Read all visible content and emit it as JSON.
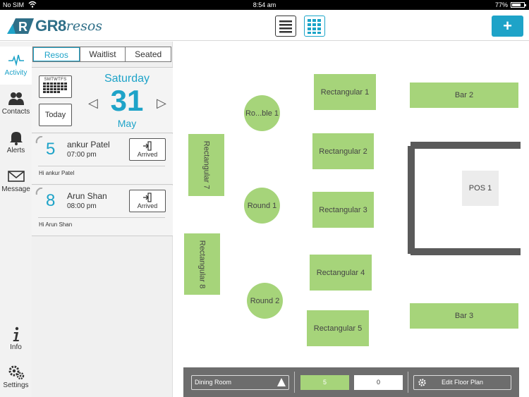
{
  "status_bar": {
    "carrier": "No SIM",
    "time": "8:54 am",
    "battery": "77%",
    "battery_level": 0.77
  },
  "header": {
    "logo_text": "GR8",
    "logo_text_italic": "resos",
    "logo_letter": "R",
    "list_view_icon": "list-icon",
    "grid_view_icon": "grid-icon",
    "add_label": "+"
  },
  "nav": {
    "items": [
      {
        "label": "Activity",
        "icon": "activity-icon",
        "active": true
      },
      {
        "label": "Contacts",
        "icon": "contacts-icon"
      },
      {
        "label": "Alerts",
        "icon": "bell-icon"
      },
      {
        "label": "Message",
        "icon": "envelope-icon"
      },
      {
        "label": "Info",
        "icon": "info-icon"
      },
      {
        "label": "Settings",
        "icon": "gear-icon"
      }
    ]
  },
  "panel": {
    "tabs": [
      {
        "label": "Resos",
        "active": true
      },
      {
        "label": "Waitlist"
      },
      {
        "label": "Seated"
      }
    ],
    "calendar_days": "SMTWTFS",
    "today_label": "Today",
    "prev_arrow": "◁",
    "next_arrow": "▷",
    "date": {
      "day_name": "Saturday",
      "day": "31",
      "month": "May"
    },
    "reservations": [
      {
        "party": "5",
        "name": "ankur Patel",
        "time": "07:00 pm",
        "status": "Arrived",
        "note": "Hi ankur Patel"
      },
      {
        "party": "8",
        "name": "Arun Shan",
        "time": "08:00 pm",
        "status": "Arrived",
        "note": "Hi Arun Shan"
      }
    ]
  },
  "floor": {
    "tables": [
      {
        "name": "Rectangular 1",
        "shape": "rect"
      },
      {
        "name": "Ro...ble 1",
        "shape": "round"
      },
      {
        "name": "Rectangular 2",
        "shape": "rect"
      },
      {
        "name": "Round 1",
        "shape": "round"
      },
      {
        "name": "Rectangular 3",
        "shape": "rect"
      },
      {
        "name": "Rectangular 4",
        "shape": "rect"
      },
      {
        "name": "Round 2",
        "shape": "round"
      },
      {
        "name": "Rectangular 5",
        "shape": "rect"
      },
      {
        "name": "Rectangular 7",
        "shape": "rect"
      },
      {
        "name": "Rectangular 8",
        "shape": "rect"
      },
      {
        "name": "Bar 2",
        "shape": "rect"
      },
      {
        "name": "Bar 3",
        "shape": "rect"
      }
    ],
    "pos_label": "POS 1",
    "table_color": "#a6d47a"
  },
  "toolbar": {
    "room": "Dining Room",
    "count_green": "5",
    "count_white": "0",
    "edit_label": "Edit Floor Plan"
  },
  "colors": {
    "accent": "#1ea3c8",
    "table": "#a6d47a",
    "wall": "#5a5a5a"
  }
}
